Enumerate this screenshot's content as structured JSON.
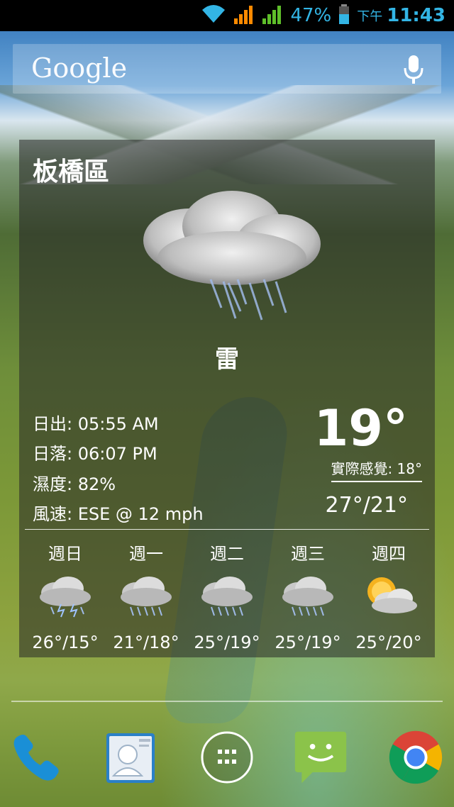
{
  "status_bar": {
    "battery_percent": "47%",
    "ampm": "下午",
    "time": "11:43",
    "icons": [
      "wifi-icon",
      "signal-orange-icon",
      "signal-green-icon",
      "battery-icon"
    ]
  },
  "search": {
    "logo_text": "Google",
    "mic_icon": "microphone-icon"
  },
  "weather": {
    "city": "板橋區",
    "condition": "雷",
    "condition_icon": "rain-cloud-icon",
    "sunrise": "日出: 05:55 AM",
    "sunset": "日落: 06:07 PM",
    "humidity": "濕度: 82%",
    "wind": "風速: ESE @ 12 mph",
    "temperature": "19°",
    "feels_like": "實際感覺: 18°",
    "range": "27°/21°",
    "forecast": [
      {
        "day": "週日",
        "temp": "26°/15°",
        "icon": "thunderstorm-icon"
      },
      {
        "day": "週一",
        "temp": "21°/18°",
        "icon": "rain-icon"
      },
      {
        "day": "週二",
        "temp": "25°/19°",
        "icon": "rain-icon"
      },
      {
        "day": "週三",
        "temp": "25°/19°",
        "icon": "rain-icon"
      },
      {
        "day": "週四",
        "temp": "25°/20°",
        "icon": "partly-cloudy-icon"
      }
    ]
  },
  "dock": {
    "items": [
      "phone-icon",
      "contacts-icon",
      "app-drawer-icon",
      "messaging-icon",
      "chrome-icon"
    ],
    "colors": {
      "phone": "#1a8fd6",
      "messaging": "#8bc34a",
      "chrome_red": "#db4437",
      "chrome_yellow": "#f4b400",
      "chrome_green": "#0f9d58",
      "chrome_blue": "#4285f4"
    }
  },
  "colors": {
    "status_accent": "#33b5e5"
  }
}
